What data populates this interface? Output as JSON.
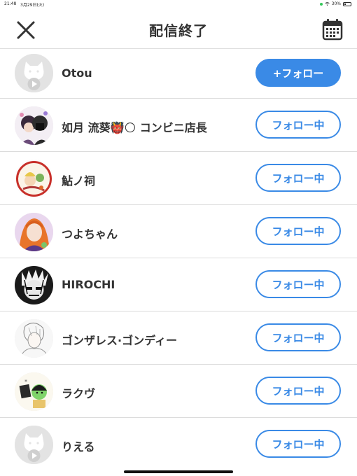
{
  "status": {
    "time": "21:48",
    "date": "3月29日(火)",
    "battery": "30%",
    "battery_level": 0.3
  },
  "header": {
    "title": "配信終了",
    "close_icon": "close-icon",
    "calendar_icon": "calendar-icon"
  },
  "colors": {
    "accent": "#3a8ae6",
    "divider": "#dcdcdc",
    "text": "#333333"
  },
  "users": [
    {
      "name": "Otou",
      "button": "+フォロー",
      "state": "follow",
      "avatar": "default-avatar-icon"
    },
    {
      "name": "如月 流葵👹🌕 コンビニ店長",
      "button": "フォロー中",
      "state": "following",
      "avatar": "anime-avatar-icon"
    },
    {
      "name": "鮎ノ祠",
      "button": "フォロー中",
      "state": "following",
      "avatar": "anime-avatar-icon"
    },
    {
      "name": "つよちゃん",
      "button": "フォロー中",
      "state": "following",
      "avatar": "anime-avatar-icon"
    },
    {
      "name": "HIROCHI",
      "button": "フォロー中",
      "state": "following",
      "avatar": "sketch-avatar-icon"
    },
    {
      "name": "ゴンザレス·ゴンディー",
      "button": "フォロー中",
      "state": "following",
      "avatar": "sketch-avatar-icon"
    },
    {
      "name": "ラクヴ",
      "button": "フォロー中",
      "state": "following",
      "avatar": "cartoon-avatar-icon"
    },
    {
      "name": "りえる",
      "button": "フォロー中",
      "state": "following",
      "avatar": "default-avatar-icon"
    }
  ]
}
